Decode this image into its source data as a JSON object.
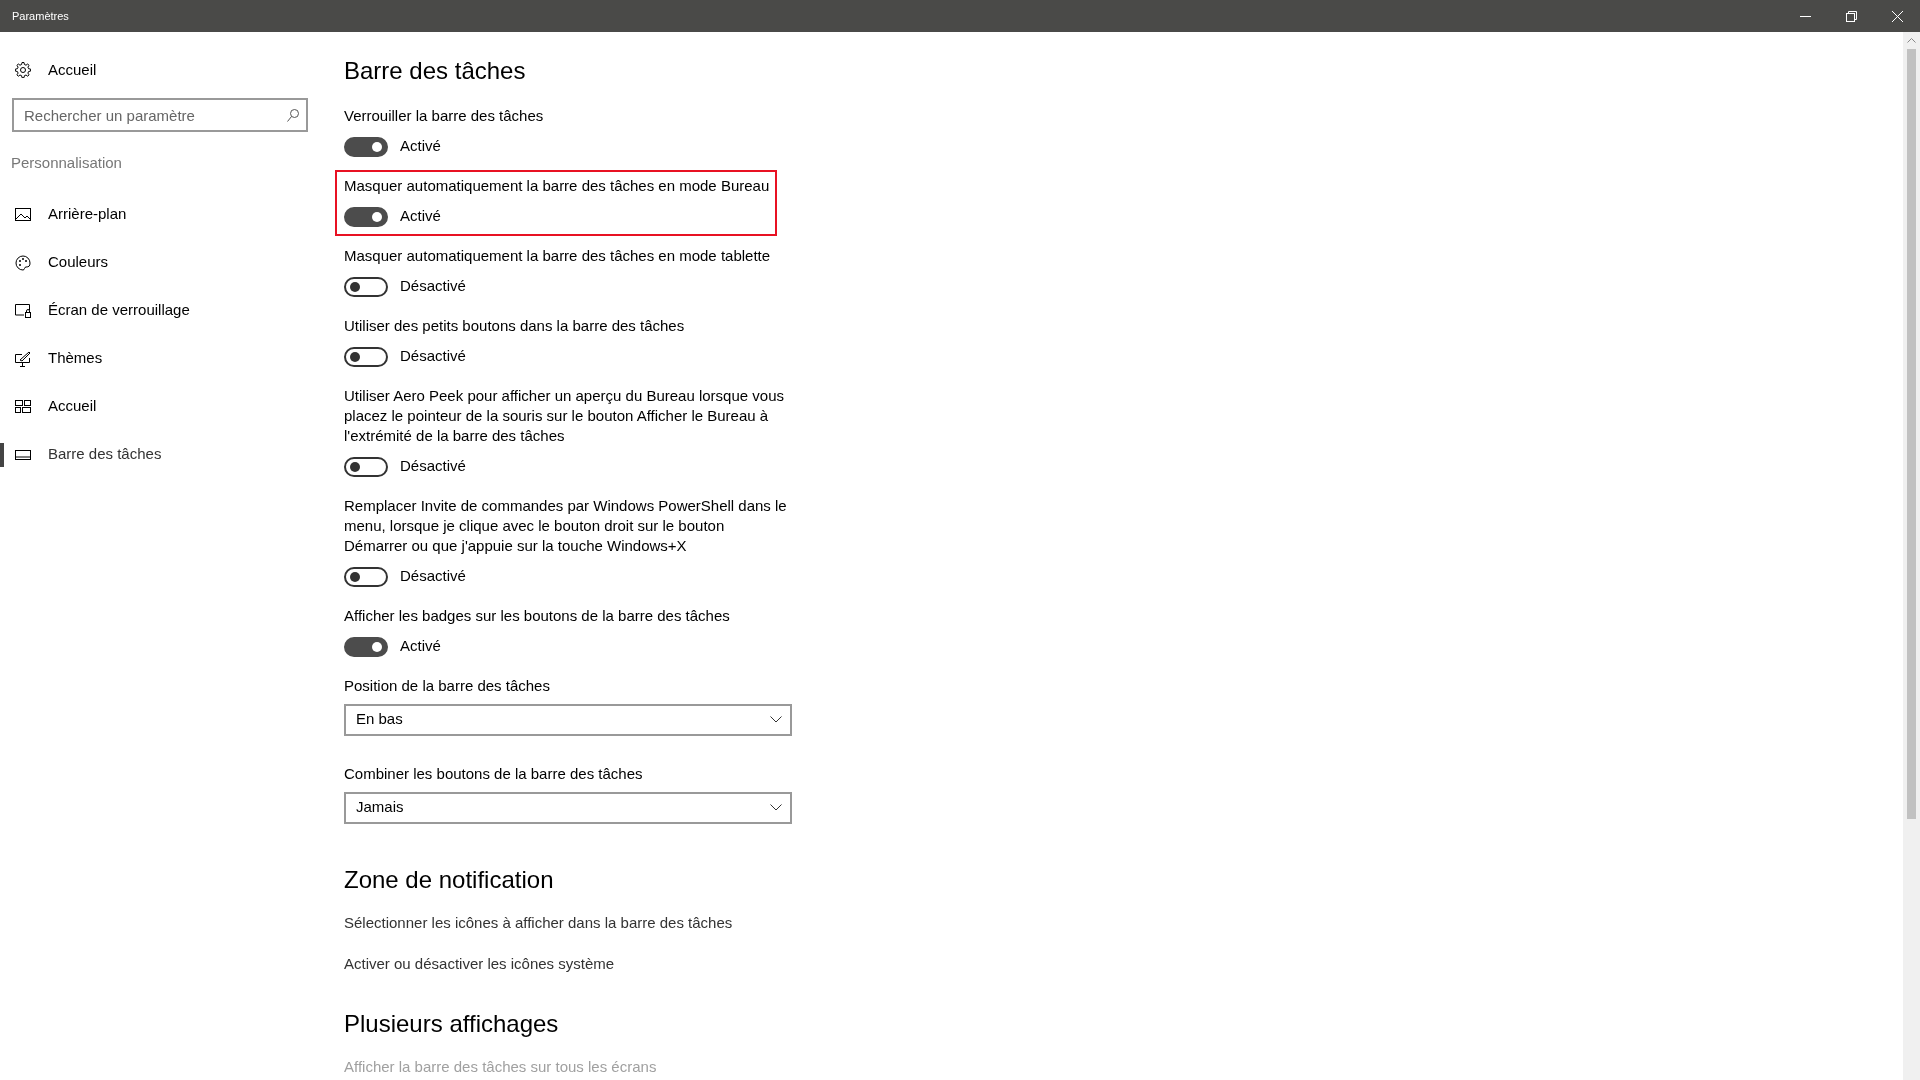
{
  "window": {
    "title": "Paramètres"
  },
  "sidebar": {
    "home": {
      "label": "Accueil"
    },
    "search": {
      "placeholder": "Rechercher un paramètre"
    },
    "group": "Personnalisation",
    "items": [
      {
        "label": "Arrière-plan",
        "selected": false
      },
      {
        "label": "Couleurs",
        "selected": false
      },
      {
        "label": "Écran de verrouillage",
        "selected": false
      },
      {
        "label": "Thèmes",
        "selected": false
      },
      {
        "label": "Accueil",
        "selected": false
      },
      {
        "label": "Barre des tâches",
        "selected": true
      }
    ]
  },
  "sections": [
    {
      "title": "Barre des tâches",
      "items": [
        {
          "kind": "toggle",
          "label": "Verrouiller la barre des tâches",
          "on": true,
          "state": "Activé",
          "highlighted": false
        },
        {
          "kind": "toggle",
          "label": "Masquer automatiquement la barre des tâches en mode Bureau",
          "on": true,
          "state": "Activé",
          "highlighted": true
        },
        {
          "kind": "toggle",
          "label": "Masquer automatiquement la barre des tâches en mode tablette",
          "on": false,
          "state": "Désactivé",
          "highlighted": false
        },
        {
          "kind": "toggle",
          "label": "Utiliser des petits boutons dans la barre des tâches",
          "on": false,
          "state": "Désactivé",
          "highlighted": false
        },
        {
          "kind": "toggle",
          "label": "Utiliser Aero Peek pour afficher un aperçu du Bureau lorsque vous placez le pointeur de la souris sur le bouton Afficher le Bureau à l'extrémité de la barre des tâches",
          "on": false,
          "state": "Désactivé",
          "highlighted": false
        },
        {
          "kind": "toggle",
          "label": "Remplacer Invite de commandes par Windows PowerShell dans le menu, lorsque je clique avec le bouton droit sur le bouton Démarrer ou que j'appuie sur la touche Windows+X",
          "on": false,
          "state": "Désactivé",
          "highlighted": false
        },
        {
          "kind": "toggle",
          "label": "Afficher les badges sur les boutons de la barre des tâches",
          "on": true,
          "state": "Activé",
          "highlighted": false
        },
        {
          "kind": "dropdown",
          "label": "Position de la barre des tâches",
          "value": "En bas"
        },
        {
          "kind": "dropdown",
          "label": "Combiner les boutons de la barre des tâches",
          "value": "Jamais"
        }
      ]
    },
    {
      "title": "Zone de notification",
      "items": [
        {
          "kind": "link",
          "label": "Sélectionner les icônes à afficher dans la barre des tâches",
          "disabled": false
        },
        {
          "kind": "link",
          "label": "Activer ou désactiver les icônes système",
          "disabled": false
        }
      ]
    },
    {
      "title": "Plusieurs affichages",
      "items": [
        {
          "kind": "link",
          "label": "Afficher la barre des tâches sur tous les écrans",
          "disabled": true
        }
      ]
    }
  ]
}
